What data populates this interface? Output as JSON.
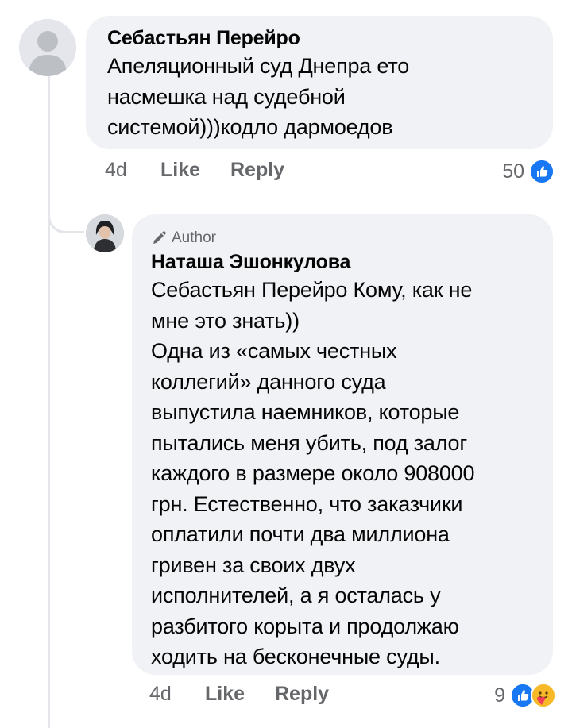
{
  "comments": [
    {
      "author": "Себастьян Перейро",
      "text": "Апеляционный суд Днепра ето\nнасмешка над судебной\nсистемой)))кодло дармоедов",
      "avatar_icon": "default-user-icon",
      "time": "4d",
      "like_label": "Like",
      "reply_label": "Reply",
      "reaction_count": "50",
      "reactions": [
        "like-reaction-icon"
      ]
    },
    {
      "badge": "Author",
      "badge_icon": "pencil-icon",
      "author": "Наташа Эшонкулова",
      "text": "Себастьян Перейро Кому, как не\nмне это знать))\nОдна из «самых честных\nколлегий» данного суда\nвыпустила наемников, которые\nпытались меня убить, под залог\nкаждого в размере около 908000\nгрн. Естественно, что заказчики\nоплатили почти два миллиона\nгривен за своих двух\nисполнителей, а я осталась у\nразбитого корыта и продолжаю\nходить на бесконечные суды.",
      "avatar_icon": "profile-photo-avatar",
      "time": "4d",
      "like_label": "Like",
      "reply_label": "Reply",
      "reaction_count": "9",
      "reactions": [
        "like-reaction-icon",
        "care-reaction-icon"
      ]
    }
  ],
  "colors": {
    "bubble_bg": "#f0f2f5",
    "meta_text": "#65676b",
    "like_blue": "#1877f2",
    "care_yellow": "#f7b928",
    "thread_line": "#e4e6eb"
  }
}
